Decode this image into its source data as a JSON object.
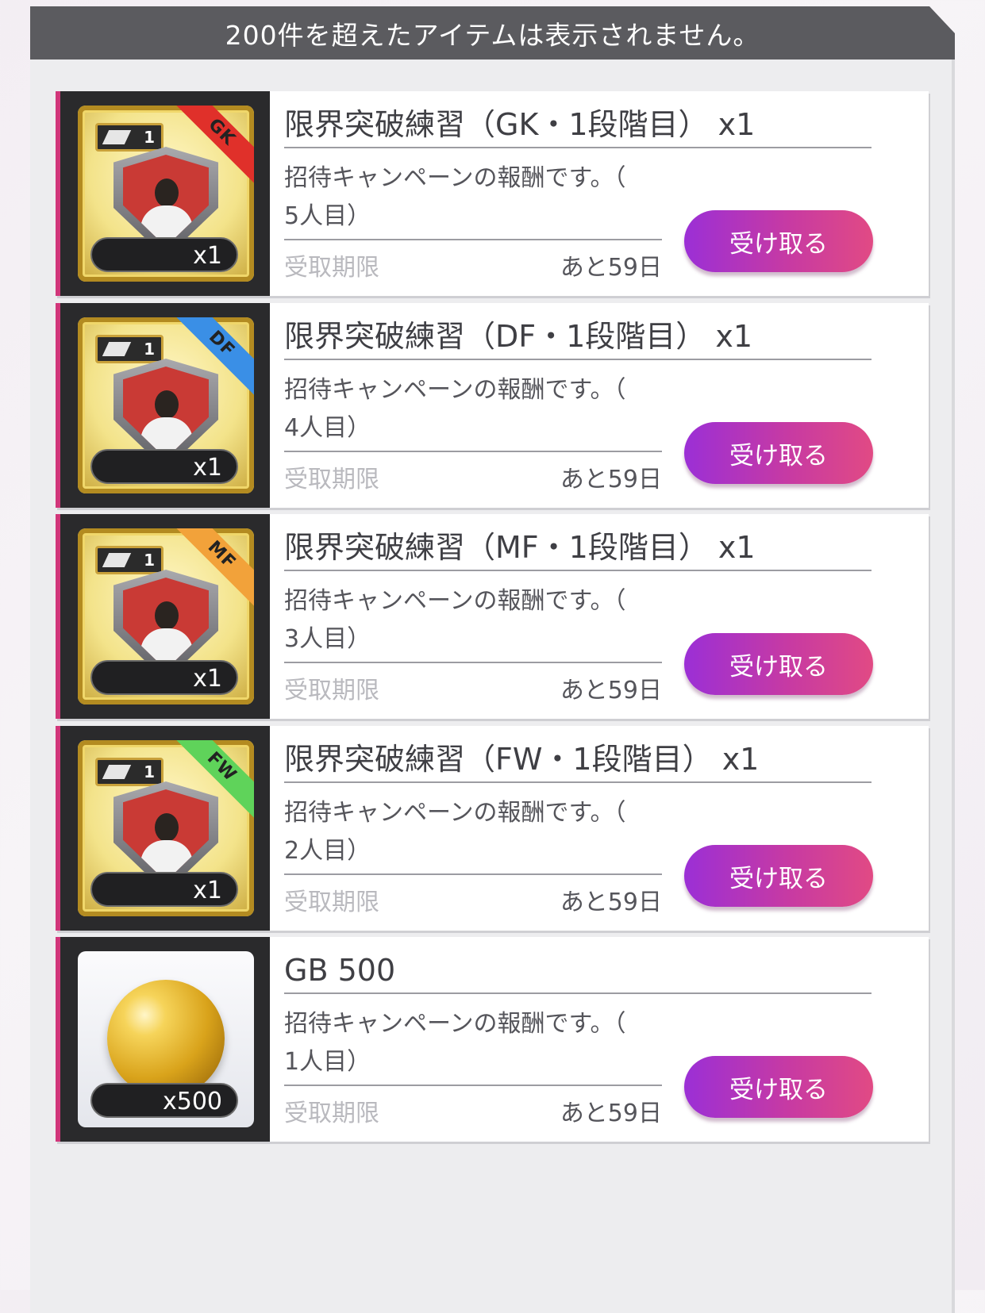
{
  "header": {
    "notice": "200件を超えたアイテムは表示されません。"
  },
  "colors": {
    "accent": "#d1367a",
    "button_start": "#9b2fd6",
    "button_end": "#e14a84",
    "header_bg": "#5b5b5f"
  },
  "items": [
    {
      "title": "限界突破練習（GK・1段階目） x1",
      "desc_line1": "招待キャンペーンの報酬です。（",
      "desc_line2": "5人目）",
      "expire_label": "受取期限",
      "expire_value": "あと59日",
      "button_label": "受け取る",
      "qty": "x1",
      "level": "1",
      "position": "GK",
      "position_color": "#e0302a",
      "icon": "limit-break-gk-icon"
    },
    {
      "title": "限界突破練習（DF・1段階目） x1",
      "desc_line1": "招待キャンペーンの報酬です。（",
      "desc_line2": "4人目）",
      "expire_label": "受取期限",
      "expire_value": "あと59日",
      "button_label": "受け取る",
      "qty": "x1",
      "level": "1",
      "position": "DF",
      "position_color": "#3a8fe6",
      "icon": "limit-break-df-icon"
    },
    {
      "title": "限界突破練習（MF・1段階目） x1",
      "desc_line1": "招待キャンペーンの報酬です。（",
      "desc_line2": "3人目）",
      "expire_label": "受取期限",
      "expire_value": "あと59日",
      "button_label": "受け取る",
      "qty": "x1",
      "level": "1",
      "position": "MF",
      "position_color": "#f2a23a",
      "icon": "limit-break-mf-icon"
    },
    {
      "title": "限界突破練習（FW・1段階目） x1",
      "desc_line1": "招待キャンペーンの報酬です。（",
      "desc_line2": "2人目）",
      "expire_label": "受取期限",
      "expire_value": "あと59日",
      "button_label": "受け取る",
      "qty": "x1",
      "level": "1",
      "position": "FW",
      "position_color": "#5fd35a",
      "icon": "limit-break-fw-icon"
    },
    {
      "title": "GB 500",
      "desc_line1": "招待キャンペーンの報酬です。（",
      "desc_line2": "1人目）",
      "expire_label": "受取期限",
      "expire_value": "あと59日",
      "button_label": "受け取る",
      "qty": "x500",
      "icon": "gold-ball-icon"
    }
  ]
}
